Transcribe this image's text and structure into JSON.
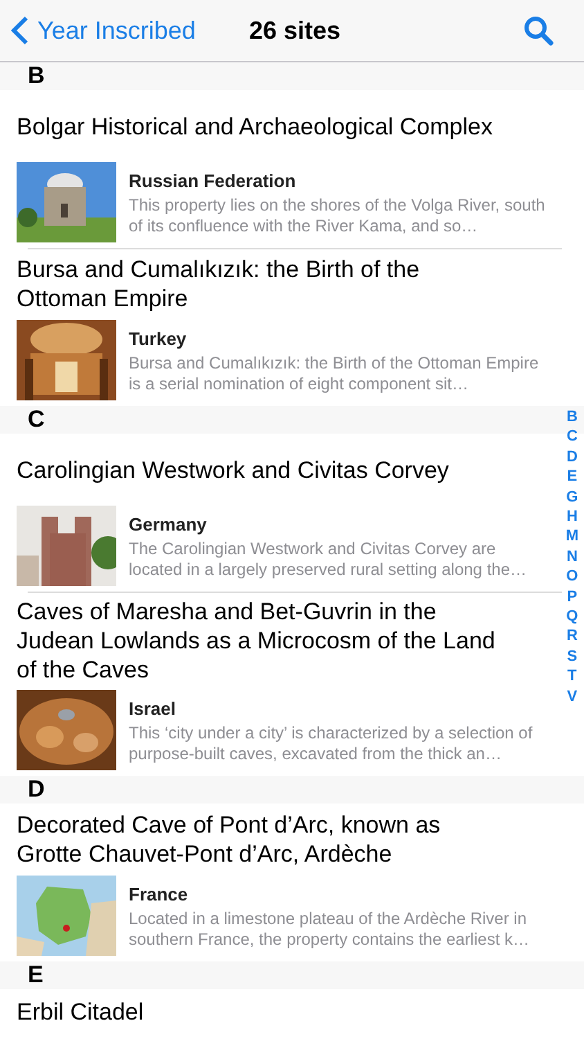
{
  "nav_bar": {
    "back_label": "Year Inscribed",
    "title": "26 sites"
  },
  "sections": [
    {
      "letter": "B",
      "sites": [
        {
          "name": "Bolgar Historical and Archaeological Complex",
          "country": "Russian Federation",
          "description": "This property lies on the shores of the Volga River, south of its confluence with the River Kama, and so…"
        },
        {
          "name": "Bursa and Cumalıkızık: the Birth of the Ottoman Empire",
          "country": "Turkey",
          "description": "Bursa and Cumalıkızık: the Birth of the Ottoman Empire is a serial nomination of eight component sit…"
        }
      ]
    },
    {
      "letter": "C",
      "sites": [
        {
          "name": "Carolingian Westwork and Civitas Corvey",
          "country": "Germany",
          "description": "The Carolingian Westwork and Civitas Corvey are located in a largely preserved rural setting along the…"
        },
        {
          "name": "Caves of Maresha and Bet-Guvrin in the Judean Lowlands as a Microcosm of the Land of the Caves",
          "country": "Israel",
          "description": "This ‘city under a city’ is characterized by a selection of purpose-built caves, excavated from the thick an…"
        }
      ]
    },
    {
      "letter": "D",
      "sites": [
        {
          "name": "Decorated Cave of Pont d’Arc, known as Grotte Chauvet-Pont d’Arc, Ardèche",
          "country": "France",
          "description": "Located in a limestone plateau of the Ardèche River in southern France, the property contains the earliest k…"
        }
      ]
    },
    {
      "letter": "E",
      "sites": [
        {
          "name": "Erbil Citadel"
        }
      ]
    }
  ],
  "section_index": [
    "B",
    "C",
    "D",
    "E",
    "G",
    "H",
    "M",
    "N",
    "O",
    "P",
    "Q",
    "R",
    "S",
    "T",
    "V"
  ]
}
